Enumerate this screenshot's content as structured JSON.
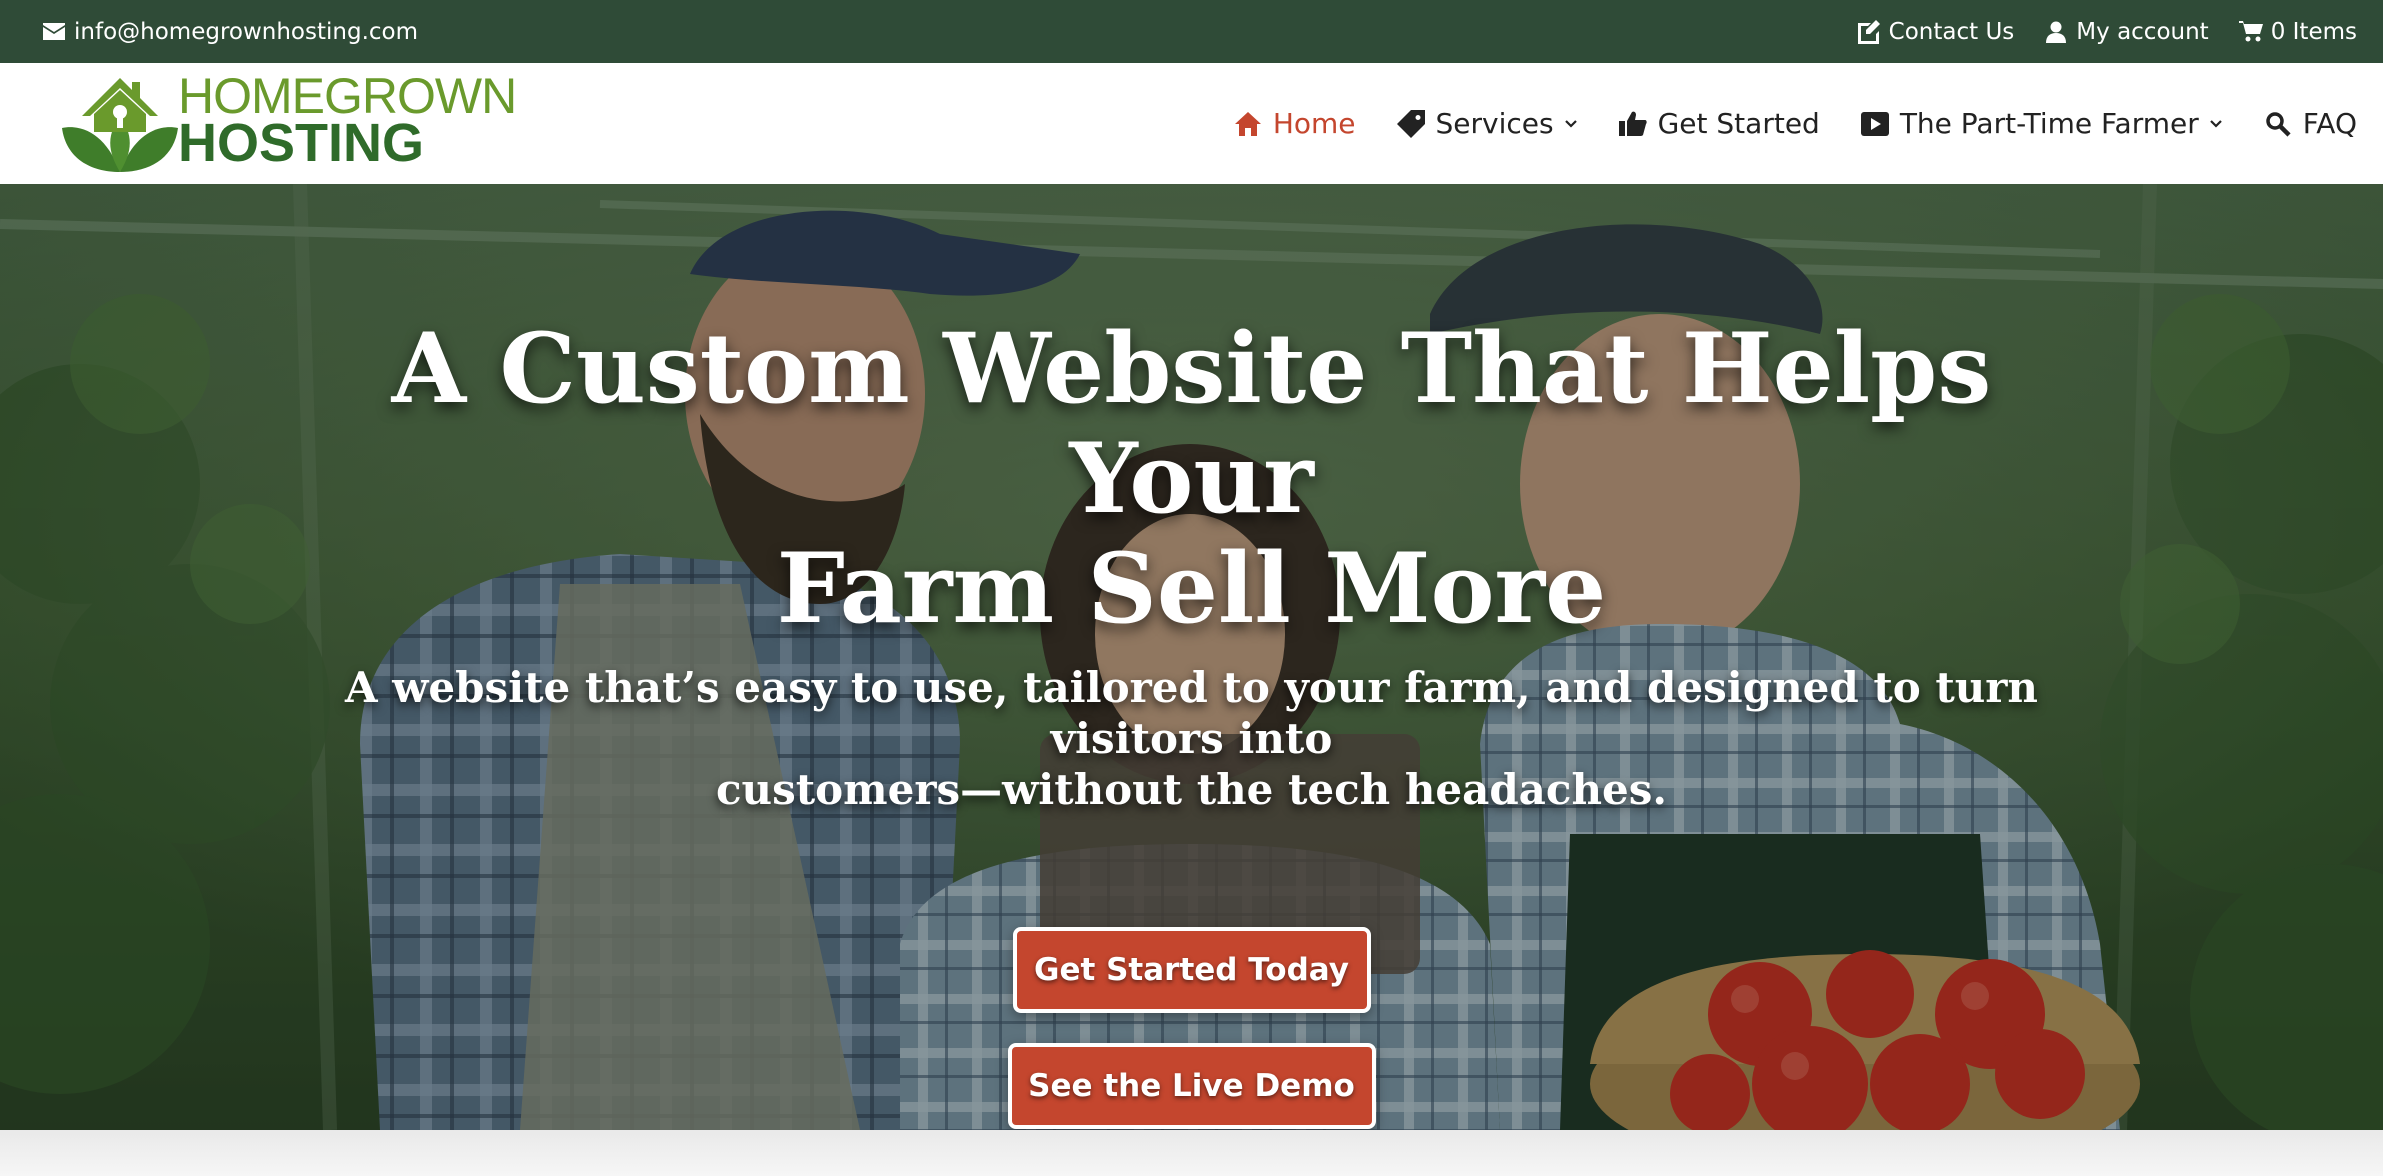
{
  "topbar": {
    "email": "info@homegrownhosting.com",
    "contact": "Contact Us",
    "account": "My account",
    "cart": "0 Items"
  },
  "logo": {
    "line1": "HOMEGROWN",
    "line2": "HOSTING"
  },
  "nav": {
    "items": [
      {
        "label": "Home",
        "icon": "home-icon"
      },
      {
        "label": "Services",
        "icon": "tag-icon"
      },
      {
        "label": "Get Started",
        "icon": "thumbs-up-icon"
      },
      {
        "label": "The Part-Time Farmer",
        "icon": "video-play-icon"
      },
      {
        "label": "FAQ",
        "icon": "search-icon"
      }
    ]
  },
  "hero": {
    "title_line1": "A Custom Website That Helps Your",
    "title_line2": "Farm Sell More",
    "subtitle_line1": "A website that’s easy to use, tailored to your farm, and designed to turn visitors into",
    "subtitle_line2": "customers—without the tech headaches.",
    "cta_primary": "Get Started Today",
    "cta_secondary": "See the Live Demo"
  },
  "colors": {
    "topbar": "#2f4b37",
    "accent": "#c4462e",
    "logo_green_light": "#6a9a2c",
    "logo_green_dark": "#2f6b2a"
  }
}
